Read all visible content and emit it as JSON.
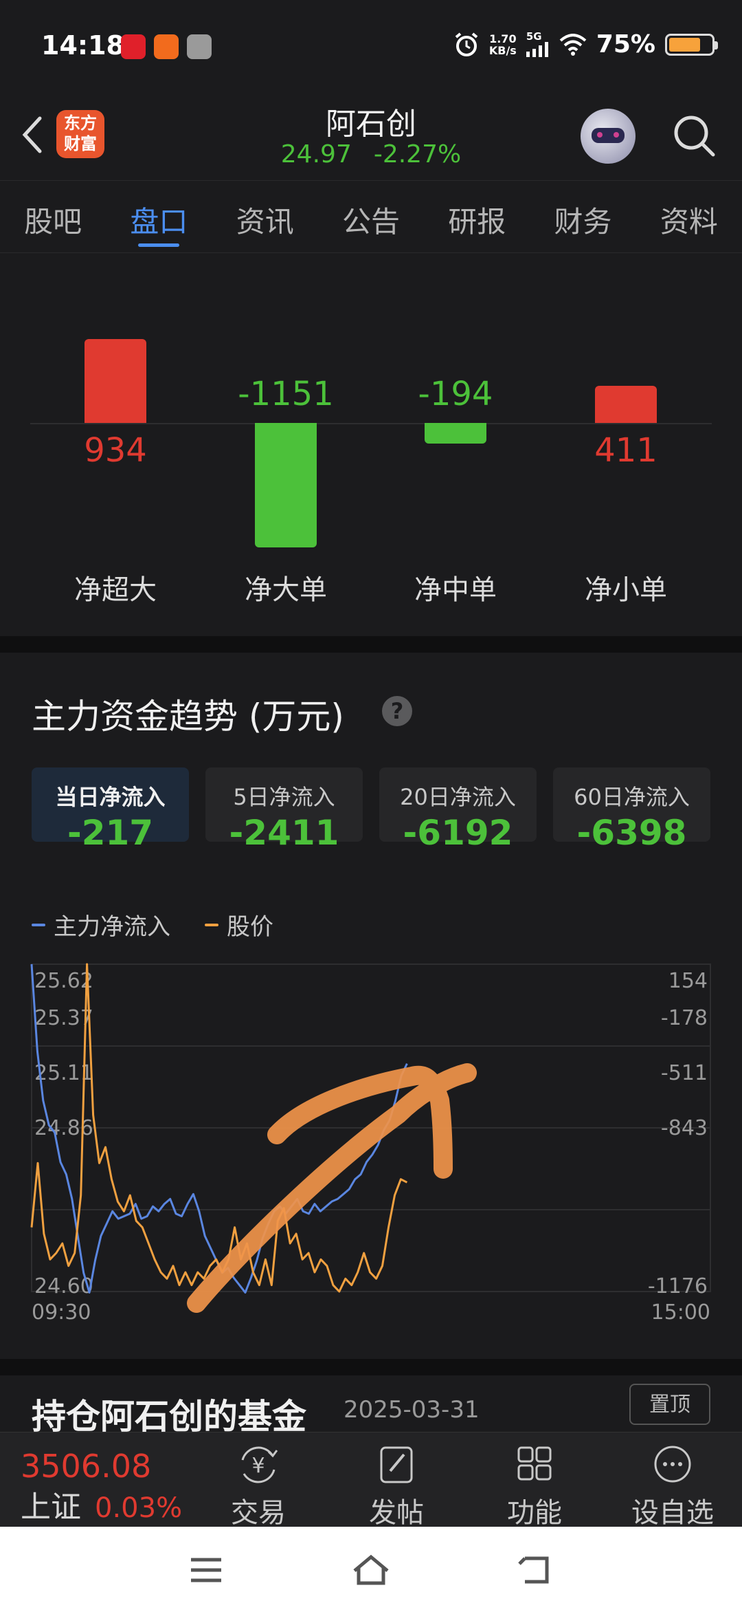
{
  "status_bar": {
    "time": "14:18",
    "net_speed_value": "1.70",
    "net_speed_unit": "KB/s",
    "signal": "5G",
    "battery": "75%",
    "battery_level": 0.75
  },
  "header": {
    "logo_line1": "东方",
    "logo_line2": "财富",
    "stock_name": "阿石创",
    "price": "24.97",
    "change_pct": "-2.27%"
  },
  "tabs": [
    {
      "label": "股吧"
    },
    {
      "label": "盘口"
    },
    {
      "label": "资讯"
    },
    {
      "label": "公告"
    },
    {
      "label": "研报"
    },
    {
      "label": "财务"
    },
    {
      "label": "资料"
    }
  ],
  "active_tab": "盘口",
  "order_flow": {
    "items": [
      {
        "label": "净超大",
        "value": "934"
      },
      {
        "label": "净大单",
        "value": "-1151"
      },
      {
        "label": "净中单",
        "value": "-194"
      },
      {
        "label": "净小单",
        "value": "411"
      }
    ]
  },
  "trend": {
    "title": "主力资金趋势 (万元)",
    "help": "?",
    "cards": [
      {
        "label": "当日净流入",
        "value": "-217"
      },
      {
        "label": "5日净流入",
        "value": "-2411"
      },
      {
        "label": "20日净流入",
        "value": "-6192"
      },
      {
        "label": "60日净流入",
        "value": "-6398"
      }
    ]
  },
  "chart_data": {
    "type": "line",
    "x_start": "09:30",
    "x_end": "15:00",
    "left_axis_ticks": [
      "25.62",
      "25.37",
      "25.11",
      "24.86",
      "24.60"
    ],
    "right_axis_ticks": [
      "154",
      "-178",
      "-511",
      "-843",
      "-1176"
    ],
    "series": [
      {
        "name": "主力净流入",
        "color": "#5a86e0",
        "axis": "right",
        "values": [
          154,
          -200,
          -400,
          -500,
          -530,
          -650,
          -700,
          -800,
          -950,
          -1100,
          -1180,
          -1050,
          -950,
          -900,
          -850,
          -880,
          -870,
          -860,
          -820,
          -880,
          -870,
          -830,
          -850,
          -820,
          -800,
          -860,
          -870,
          -820,
          -780,
          -850,
          -950,
          -1000,
          -1050,
          -1100,
          -1080,
          -1120,
          -1150,
          -1180,
          -1120,
          -1050,
          -960,
          -900,
          -850,
          -830,
          -860,
          -830,
          -800,
          -850,
          -860,
          -820,
          -850,
          -830,
          -810,
          -800,
          -780,
          -760,
          -720,
          -700,
          -650,
          -620,
          -580,
          -520,
          -480,
          -400,
          -300,
          -250
        ]
      },
      {
        "name": "股价",
        "color": "#f0a040",
        "axis": "left",
        "values": [
          24.8,
          25.0,
          24.78,
          24.7,
          24.72,
          24.75,
          24.68,
          24.72,
          24.9,
          25.62,
          25.15,
          25.0,
          25.05,
          24.95,
          24.88,
          24.85,
          24.9,
          24.82,
          24.8,
          24.75,
          24.7,
          24.66,
          24.64,
          24.68,
          24.62,
          24.66,
          24.62,
          24.66,
          24.64,
          24.68,
          24.7,
          24.66,
          24.7,
          24.8,
          24.7,
          24.75,
          24.66,
          24.62,
          24.7,
          24.62,
          24.82,
          24.86,
          24.75,
          24.78,
          24.7,
          24.72,
          24.66,
          24.7,
          24.68,
          24.62,
          24.6,
          24.64,
          24.62,
          24.66,
          24.72,
          24.66,
          24.64,
          24.68,
          24.8,
          24.9,
          24.95,
          24.94
        ]
      }
    ]
  },
  "next_section": {
    "title": "持仓阿石创的基金",
    "date": "2025-03-31",
    "button": "置顶"
  },
  "toolbar": {
    "index_value": "3506.08",
    "index_name": "上证",
    "index_pct": "0.03%",
    "items": [
      {
        "label": "交易",
        "icon": "yen-exchange-icon"
      },
      {
        "label": "发帖",
        "icon": "edit-icon"
      },
      {
        "label": "功能",
        "icon": "grid-icon"
      },
      {
        "label": "设自选",
        "icon": "more-icon"
      }
    ]
  },
  "colors": {
    "up": "#e03a30",
    "down": "#4cc13a",
    "accent": "#4b8ef0",
    "main_flow_line": "#5a86e0",
    "price_line": "#f0a040",
    "annotation": "#f0944a"
  }
}
